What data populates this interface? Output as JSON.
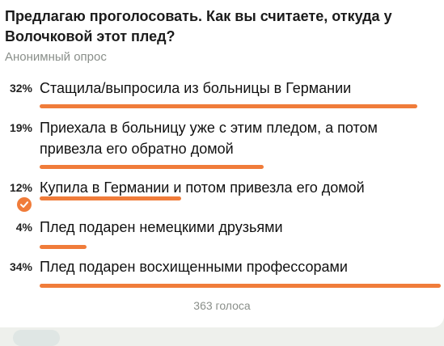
{
  "poll": {
    "question": "Предлагаю проголосовать. Как вы считаете, откуда у Волочковой этот плед?",
    "type_label": "Анонимный опрос",
    "options": [
      {
        "percent": "32%",
        "text": "Стащила/выпросила из больницы в Германии",
        "fraction": 0.32
      },
      {
        "percent": "19%",
        "text": "Приехала в больницу уже с этим пледом, а потом привезла его обратно домой",
        "fraction": 0.19
      },
      {
        "percent": "12%",
        "text": "Купила в Германии и потом привезла его домой",
        "fraction": 0.12,
        "selected": true
      },
      {
        "percent": "4%",
        "text": "Плед подарен немецкими друзьями",
        "fraction": 0.04
      },
      {
        "percent": "34%",
        "text": "Плед подарен восхищенными профессорами",
        "fraction": 0.34
      }
    ],
    "total_votes": "363 голоса"
  },
  "icons": {
    "selected": "check-circle-icon"
  },
  "colors": {
    "accent": "#f07c3a",
    "muted_text": "#8a8f8a",
    "background": "#ffffff"
  }
}
